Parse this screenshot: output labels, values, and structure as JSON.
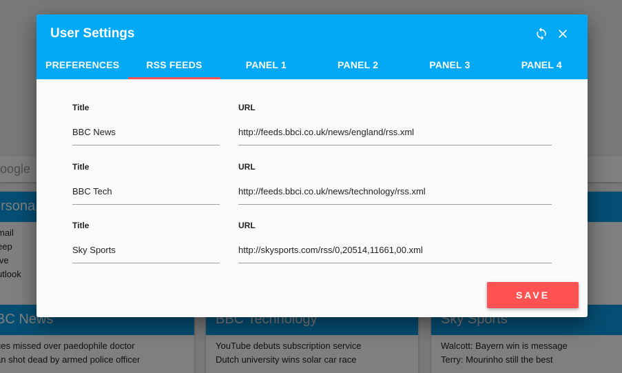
{
  "background": {
    "search_placeholder": "oogle",
    "personal_card": {
      "title": "ersona",
      "items": [
        "mail",
        "eep",
        "ive",
        "utlook"
      ]
    },
    "news_cards": [
      {
        "title": "BC News",
        "items": [
          "ues missed over paedophile doctor",
          "an shot dead by armed police officer"
        ]
      },
      {
        "title": "BBC Technology",
        "items": [
          "YouTube debuts subscription service",
          "Dutch university wins solar car race"
        ]
      },
      {
        "title": "Sky Sports",
        "items": [
          "Walcott: Bayern win is message",
          "Terry: Mourinho still the best"
        ]
      }
    ]
  },
  "dialog": {
    "title": "User Settings",
    "icons": {
      "refresh": "refresh-icon",
      "close": "close-icon"
    },
    "tabs": [
      {
        "label": "PREFERENCES",
        "active": false
      },
      {
        "label": "RSS FEEDS",
        "active": true
      },
      {
        "label": "PANEL 1",
        "active": false
      },
      {
        "label": "PANEL 2",
        "active": false
      },
      {
        "label": "PANEL 3",
        "active": false
      },
      {
        "label": "PANEL 4",
        "active": false
      }
    ],
    "feeds": [
      {
        "title_label": "Title",
        "title_value": "BBC News",
        "url_label": "URL",
        "url_value": "http://feeds.bbci.co.uk/news/england/rss.xml"
      },
      {
        "title_label": "Title",
        "title_value": "BBC Tech",
        "url_label": "URL",
        "url_value": "http://feeds.bbci.co.uk/news/technology/rss.xml"
      },
      {
        "title_label": "Title",
        "title_value": "Sky Sports",
        "url_label": "URL",
        "url_value": "http://skysports.com/rss/0,20514,11661,00.xml"
      }
    ],
    "save_label": "SAVE"
  },
  "colors": {
    "header": "#03a9f4",
    "tab_indicator": "#ff5252",
    "save_button": "#ff5252",
    "card_header": "#0a9de6"
  }
}
